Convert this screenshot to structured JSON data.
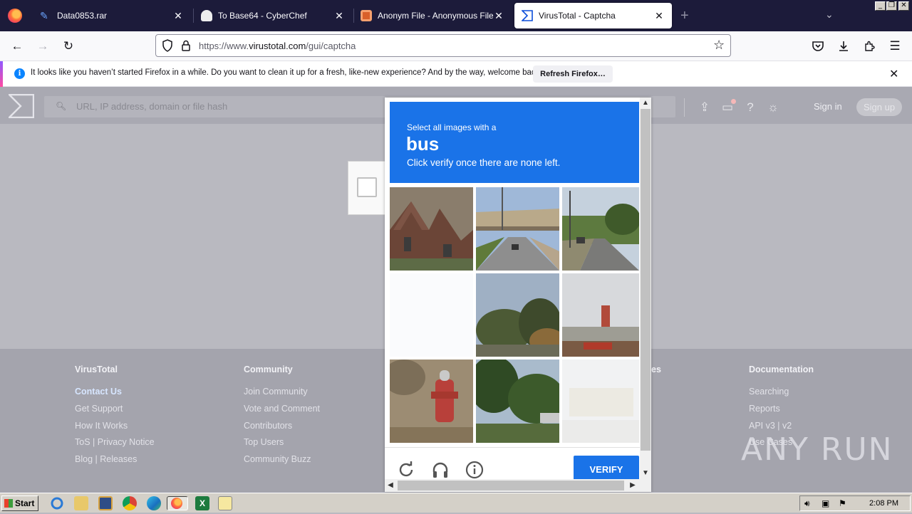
{
  "browser": {
    "tabs": [
      {
        "label": "Data0853.rar",
        "icon": "paperclip-icon"
      },
      {
        "label": "To Base64 - CyberChef",
        "icon": "cyberchef-icon"
      },
      {
        "label": "Anonym File - Anonymous File Uplo",
        "icon": "anonymfile-icon"
      },
      {
        "label": "VirusTotal - Captcha",
        "icon": "virustotal-icon"
      }
    ],
    "active_tab": 3,
    "url_prefix": "https://www.",
    "url_host": "virustotal.com",
    "url_path": "/gui/captcha"
  },
  "notification": {
    "message": "It looks like you haven’t started Firefox in a while. Do you want to clean it up for a fresh, like-new experience? And by the way, welcome back!",
    "button": "Refresh Firefox…"
  },
  "vt": {
    "search_placeholder": "URL, IP address, domain or file hash",
    "sign_in": "Sign in",
    "sign_up": "Sign up",
    "footer": {
      "col1": {
        "heading": "VirusTotal",
        "links": [
          "Contact Us",
          "Get Support",
          "How It Works",
          "ToS | Privacy Notice",
          "Blog | Releases"
        ]
      },
      "col2": {
        "heading": "Community",
        "links": [
          "Join Community",
          "Vote and Comment",
          "Contributors",
          "Top Users",
          "Community Buzz"
        ]
      },
      "col3_heading_tail": "es",
      "col4": {
        "heading": "Documentation",
        "links": [
          "Searching",
          "Reports",
          "API v3 | v2",
          "Use Cases"
        ]
      }
    }
  },
  "captcha": {
    "line1": "Select all images with a",
    "target": "bus",
    "line3": "Click verify once there are none left.",
    "verify": "VERIFY"
  },
  "watermark": "ANY RUN",
  "taskbar": {
    "start": "Start",
    "clock": "2:08 PM"
  },
  "colors": {
    "captcha_blue": "#1a73e8",
    "firefox_tabstrip": "#1c1b3a"
  }
}
